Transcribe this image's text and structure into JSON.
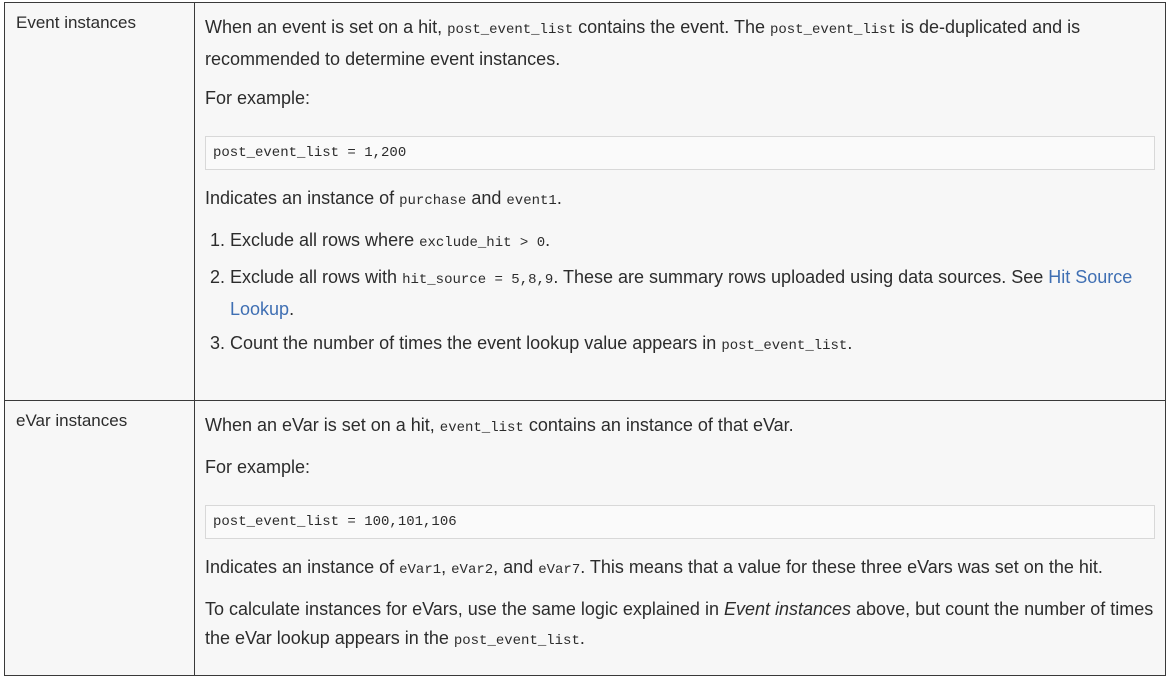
{
  "rows": [
    {
      "term": "Event instances",
      "intro": {
        "t1": "When an event is set on a hit, ",
        "c1": "post_event_list",
        "t2": " contains the event. The ",
        "c2": "post_event_list",
        "t3": " is de-duplicated and is recommended to determine event instances."
      },
      "for_example": "For example:",
      "code": "post_event_list = 1,200",
      "indicates": {
        "t1": "Indicates an instance of ",
        "c1": "purchase",
        "t2": " and ",
        "c2": "event1",
        "t3": "."
      },
      "steps": [
        {
          "t1": "Exclude all rows where ",
          "c1": "exclude_hit > 0",
          "t2": "."
        },
        {
          "t1": "Exclude all rows with ",
          "c1": "hit_source = 5,8,9",
          "t2": ". These are summary rows uploaded using data sources. See ",
          "link": "Hit Source Lookup",
          "t3": "."
        },
        {
          "t1": "Count the number of times the event lookup value appears in ",
          "c1": "post_event_list",
          "t2": "."
        }
      ]
    },
    {
      "term": "eVar instances",
      "intro": {
        "t1": "When an eVar is set on a hit, ",
        "c1": "event_list",
        "t2": " contains an instance of that eVar."
      },
      "for_example": "For example:",
      "code": "post_event_list = 100,101,106",
      "indicates": {
        "t1": "Indicates an instance of ",
        "c1": "eVar1",
        "t2": ", ",
        "c2": "eVar2",
        "t3": ", and ",
        "c3": "eVar7",
        "t4": ". This means that a value for these three eVars was set on the hit."
      },
      "calc": {
        "t1": "To calculate instances for eVars, use the same logic explained in ",
        "em": "Event instances",
        "t2": " above, but count the number of times the eVar lookup appears in the ",
        "c1": "post_event_list",
        "t3": "."
      }
    }
  ]
}
